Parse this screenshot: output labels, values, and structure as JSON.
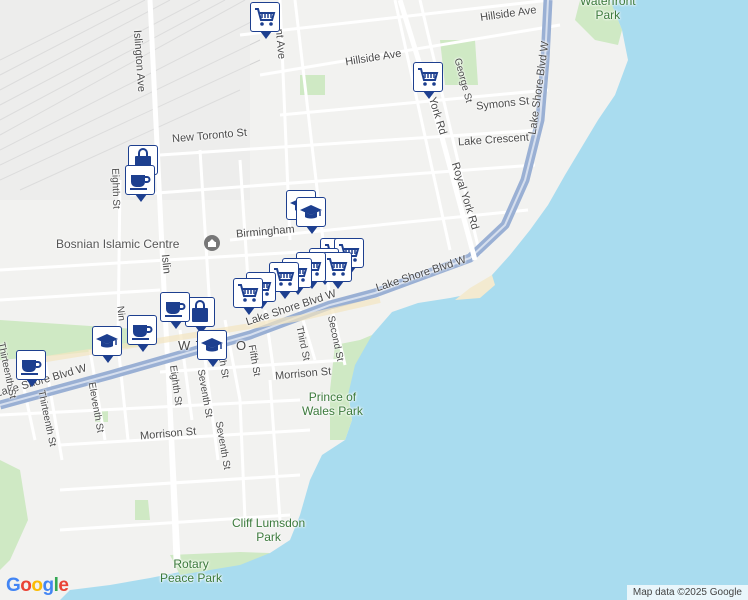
{
  "map": {
    "attribution": "Map data ©2025 Google",
    "logo": {
      "letters": [
        "G",
        "o",
        "o",
        "g",
        "l",
        "e"
      ],
      "colors": [
        "#4285F4",
        "#EA4335",
        "#FBBC05",
        "#4285F4",
        "#34A853",
        "#EA4335"
      ]
    },
    "colors": {
      "water": "#a9dcef",
      "park": "#cfe9c4",
      "road": "#ffffff",
      "highway": "#9ab0d4",
      "marker": "#1d3f8f",
      "land": "#f2f2f0"
    }
  },
  "streets": {
    "hillside_ave_e": "Hillside Ave",
    "hillside_ave_w": "Hillside Ave",
    "george_st": "George St",
    "symons_st": "Symons St",
    "new_toronto_st": "New Toronto St",
    "lake_crescent": "Lake Crescent",
    "islington_ave": "Islington Ave",
    "eighth_st_n": "Eighth St",
    "birmingham": "Birmingham",
    "royal_york_rd": "Royal York Rd",
    "york_rd": "York Rd",
    "lake_shore_e": "Lake Shore Blvd W",
    "lake_shore_mid": "Lake Shore Blvd W",
    "lake_shore_w": "Lake Shore Blvd W",
    "lake_shore_east_vert": "Lake Shore Blvd W",
    "third_st": "Third St",
    "second_st": "Second St",
    "fifth_st": "Fifth St",
    "morrison_st_e": "Morrison St",
    "morrison_st_w": "Morrison St",
    "eighth_st_s": "Eighth St",
    "seventh_st": "Seventh St",
    "seventh_st2": "Seventh St",
    "eleventh_st": "Eleventh St",
    "thirteenth_st": "Thirteenth St",
    "thirteenth_st2": "Thirteenth St",
    "ninth_st": "Nin",
    "sixth_st": "xth St",
    "islington_s": "Islin",
    "nt_ave": "nt Ave",
    "new_toronto_area": "W TO",
    "new_toronto_area2": "O"
  },
  "places": {
    "waterfront_park": "Waterfront\nPark",
    "bosnian_centre": "Bosnian Islamic Centre",
    "prince_of_wales_park": "Prince of\nWales Park",
    "cliff_lumsdon_park": "Cliff Lumsdon\nPark",
    "rotary_peace_park": "Rotary\nPeace Park"
  },
  "markers": [
    {
      "type": "cart-icon",
      "name": "grocery-marker"
    },
    {
      "type": "cart-icon",
      "name": "grocery-marker"
    },
    {
      "type": "bag-icon",
      "name": "shop-marker"
    },
    {
      "type": "cup-icon",
      "name": "cafe-marker"
    },
    {
      "type": "cap-icon",
      "name": "school-marker"
    },
    {
      "type": "cap-icon",
      "name": "school-marker"
    },
    {
      "type": "cart-icon",
      "name": "grocery-marker"
    },
    {
      "type": "cart-icon",
      "name": "grocery-marker"
    },
    {
      "type": "cart-icon",
      "name": "grocery-marker"
    },
    {
      "type": "cart-icon",
      "name": "grocery-marker"
    },
    {
      "type": "cart-icon",
      "name": "grocery-marker"
    },
    {
      "type": "cart-icon",
      "name": "grocery-marker"
    },
    {
      "type": "cart-icon",
      "name": "grocery-marker"
    },
    {
      "type": "cart-icon",
      "name": "grocery-marker"
    },
    {
      "type": "cart-icon",
      "name": "grocery-marker"
    },
    {
      "type": "bag-icon",
      "name": "shop-marker"
    },
    {
      "type": "cup-icon",
      "name": "cafe-marker"
    },
    {
      "type": "cup-icon",
      "name": "cafe-marker"
    },
    {
      "type": "cap-icon",
      "name": "school-marker"
    },
    {
      "type": "cap-icon",
      "name": "school-marker"
    },
    {
      "type": "cup-icon",
      "name": "cafe-marker"
    }
  ]
}
